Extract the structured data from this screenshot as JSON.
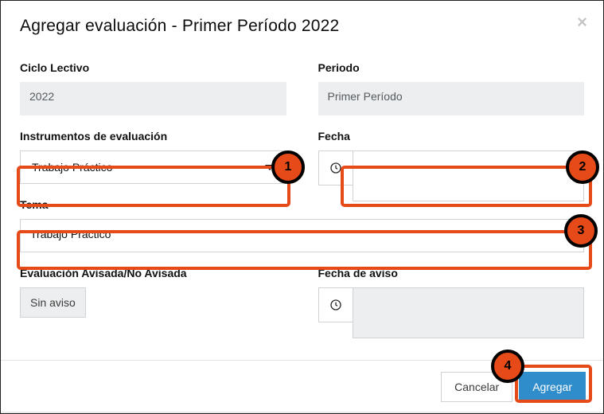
{
  "header": {
    "title": "Agregar evaluación - Primer Período 2022"
  },
  "labels": {
    "ciclo": "Ciclo Lectivo",
    "periodo": "Periodo",
    "instrumento": "Instrumentos de evaluación",
    "fecha": "Fecha",
    "tema": "Tema",
    "avisada": "Evaluación Avisada/No Avisada",
    "fecha_aviso": "Fecha de aviso"
  },
  "fields": {
    "ciclo_value": "2022",
    "periodo_value": "Primer Período",
    "instrumento_value": "Trabajo Práctico",
    "fecha_value": "",
    "tema_value": "Trabajo Práctico",
    "avisada_button": "Sin aviso",
    "fecha_aviso_value": ""
  },
  "footer": {
    "cancel": "Cancelar",
    "add": "Agregar"
  },
  "callouts": {
    "c1": "1",
    "c2": "2",
    "c3": "3",
    "c4": "4"
  }
}
